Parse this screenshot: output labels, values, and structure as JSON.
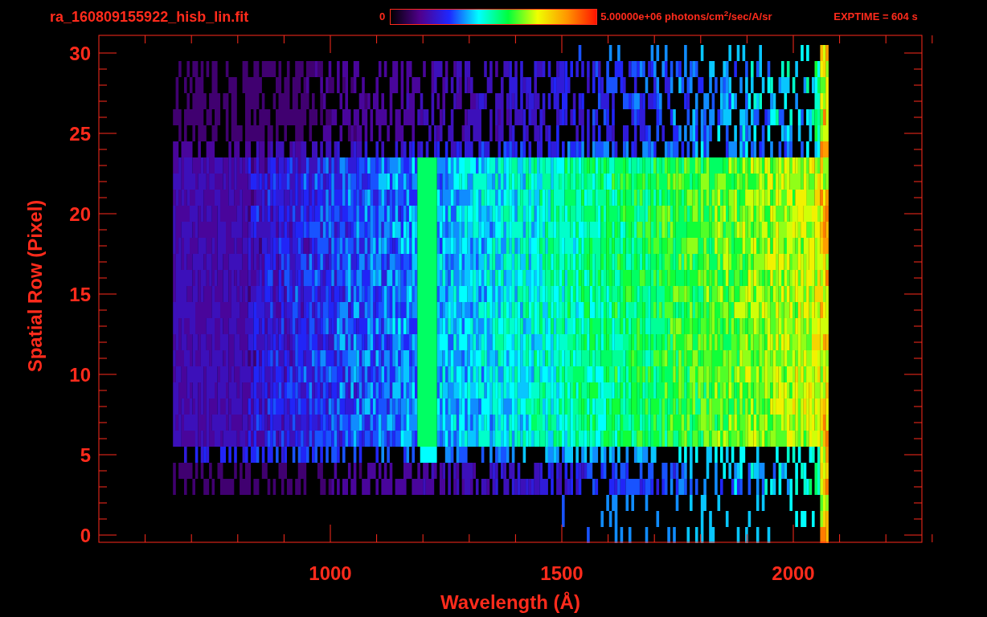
{
  "title": "ra_160809155922_hisb_lin.fit",
  "colorbar": {
    "min_label": "0",
    "max_label": "5.00000e+06 photons/cm$^{2}$/sec/A/sr"
  },
  "exposure": "EXPTIME = 604 s",
  "plot": {
    "xlabel": "Wavelength (Å)",
    "ylabel": "Spatial Row (Pixel)",
    "xticks": [
      "1000",
      "1500",
      "2000"
    ],
    "yticks": [
      "30",
      "25",
      "20",
      "15",
      "10",
      "5",
      "0"
    ]
  }
}
